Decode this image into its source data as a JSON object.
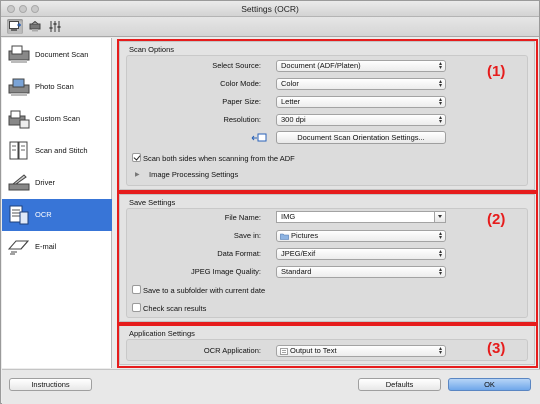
{
  "window": {
    "title": "Settings (OCR)"
  },
  "toolbar": {
    "icons": [
      "scan-from-computer-icon",
      "scan-from-operation-panel-icon",
      "general-settings-icon"
    ]
  },
  "sidebar": {
    "items": [
      {
        "label": "Document Scan",
        "icon": "document-scan-icon"
      },
      {
        "label": "Photo Scan",
        "icon": "photo-scan-icon"
      },
      {
        "label": "Custom Scan",
        "icon": "custom-scan-icon"
      },
      {
        "label": "Scan and Stitch",
        "icon": "scan-and-stitch-icon"
      },
      {
        "label": "Driver",
        "icon": "driver-icon"
      },
      {
        "label": "OCR",
        "icon": "ocr-icon",
        "selected": true
      },
      {
        "label": "E-mail",
        "icon": "email-icon"
      }
    ]
  },
  "scan_options": {
    "title": "Scan Options",
    "select_source_label": "Select Source:",
    "select_source_value": "Document (ADF/Platen)",
    "color_mode_label": "Color Mode:",
    "color_mode_value": "Color",
    "paper_size_label": "Paper Size:",
    "paper_size_value": "Letter",
    "resolution_label": "Resolution:",
    "resolution_value": "300 dpi",
    "orientation_button": "Document Scan Orientation Settings...",
    "scan_both_sides_label": "Scan both sides when scanning from the ADF",
    "scan_both_sides_checked": true,
    "image_processing_label": "Image Processing Settings"
  },
  "save_settings": {
    "title": "Save Settings",
    "file_name_label": "File Name:",
    "file_name_value": "IMG",
    "save_in_label": "Save in:",
    "save_in_value": "Pictures",
    "data_format_label": "Data Format:",
    "data_format_value": "JPEG/Exif",
    "jpeg_quality_label": "JPEG Image Quality:",
    "jpeg_quality_value": "Standard",
    "subfolder_label": "Save to a subfolder with current date",
    "subfolder_checked": false,
    "check_results_label": "Check scan results",
    "check_results_checked": false
  },
  "application_settings": {
    "title": "Application Settings",
    "ocr_app_label": "OCR Application:",
    "ocr_app_value": "Output to Text"
  },
  "callouts": {
    "one": "(1)",
    "two": "(2)",
    "three": "(3)",
    "color": "#e61c1c"
  },
  "footer": {
    "instructions_button": "Instructions",
    "defaults_button": "Defaults",
    "ok_button": "OK"
  },
  "colors": {
    "selection": "#3875d7",
    "accent_button": "#6fa7ea"
  }
}
